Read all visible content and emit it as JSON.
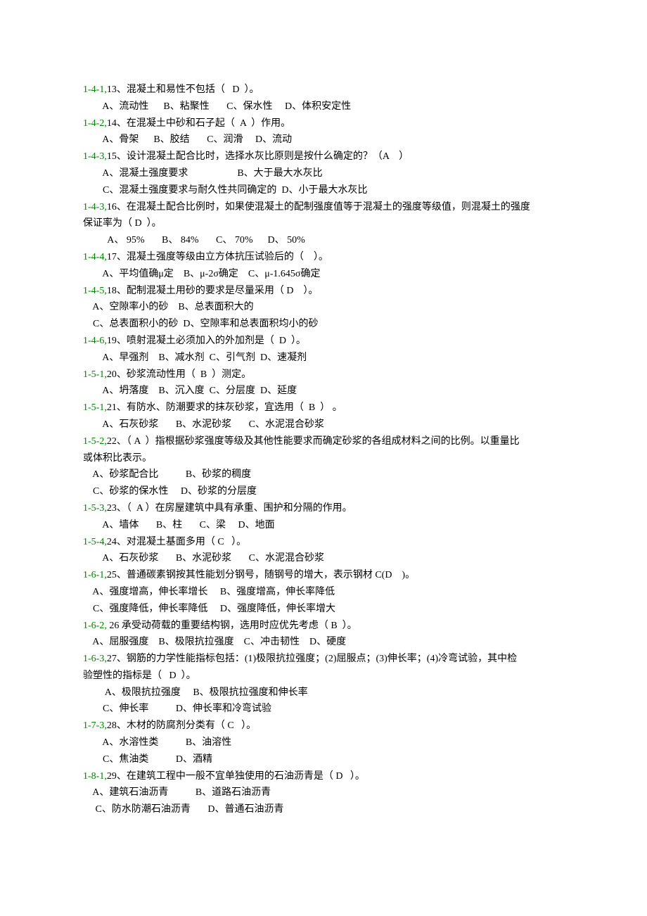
{
  "lines": [
    {
      "qnum": "1-4-1,",
      "rest": "13、混凝土和易性不包括（   D  ）。"
    },
    {
      "qnum": "",
      "rest": "        A、流动性      B、粘聚性       C、保水性     D、体积安定性"
    },
    {
      "qnum": "1-4-2,",
      "rest": "14、在混凝土中砂和石子起（  A  ）作用。"
    },
    {
      "qnum": "",
      "rest": "        A、骨架      B、胶结       C、润滑     D、流动"
    },
    {
      "qnum": "1-4-3,",
      "rest": "15、设计混凝土配合比时，选择水灰比原则是按什么确定的？（A    ）"
    },
    {
      "qnum": "",
      "rest": "        A、混凝土强度要求                    B、大于最大水灰比"
    },
    {
      "qnum": "",
      "rest": "        C、混凝土强度要求与耐久性共同确定的  D、小于最大水灰比"
    },
    {
      "qnum": "1-4-3,",
      "rest": "16、在混凝土配合比例时，如果使混凝土的配制强度值等于混凝土的强度等级值，则混凝土的强度"
    },
    {
      "qnum": "",
      "rest": "保证率为（ D  ）。"
    },
    {
      "qnum": "",
      "rest": "          A、 95%       B、 84%       C、 70%      D、 50%"
    },
    {
      "qnum": "1-4-4,",
      "rest": "17、混凝土强度等级由立方体抗压试验后的（    ）。"
    },
    {
      "qnum": "",
      "rest": "        A、平均值确μ定    B、μ-2σ确定    C、μ-1.645σ确定"
    },
    {
      "qnum": "1-4-5,",
      "rest": "18、配制混凝土用砂的要求是尽量采用（ D    ）。"
    },
    {
      "qnum": "",
      "rest": "    A、空隙率小的砂    B、总表面积大的"
    },
    {
      "qnum": "",
      "rest": "    C、总表面积小的砂  D、空隙率和总表面积均小的砂"
    },
    {
      "qnum": "1-4-6,",
      "rest": "19、喷射混凝土必须加入的外加剂是（  D  ）。"
    },
    {
      "qnum": "",
      "rest": "        A、早强剂    B、减水剂  C、引气剂  D、速凝剂"
    },
    {
      "qnum": "1-5-1,",
      "rest": "20、砂浆流动性用（  B  ）测定。"
    },
    {
      "qnum": "",
      "rest": "        A、坍落度    B、沉入度  C、分层度  D、延度"
    },
    {
      "qnum": "1-5-1,",
      "rest": "21、有防水、防潮要求的抹灰砂浆，宜选用（  B  ） 。"
    },
    {
      "qnum": "",
      "rest": "        A、石灰砂浆       B、水泥砂浆       C、水泥混合砂浆"
    },
    {
      "qnum": "1-5-2,",
      "rest": "22、（ A  ）指根据砂浆强度等级及其他性能要求而确定砂浆的各组成材料之间的比例。以重量比"
    },
    {
      "qnum": "",
      "rest": "或体积比表示。"
    },
    {
      "qnum": "",
      "rest": "    A、砂浆配合比           B、砂浆的稠度"
    },
    {
      "qnum": "",
      "rest": "    C、砂浆的保水性     D、砂浆的分层度"
    },
    {
      "qnum": "1-5-3,",
      "rest": "23、（  A ）在房屋建筑中具有承重、围护和分隔的作用。"
    },
    {
      "qnum": "",
      "rest": "        A、墙体       B、柱       C、梁     D、地面"
    },
    {
      "qnum": "1-5-4,",
      "rest": "24、对混凝土基面多用（ C   ）。"
    },
    {
      "qnum": "",
      "rest": "        A、石灰砂浆       B、水泥砂浆       C、水泥混合砂浆"
    },
    {
      "qnum": "1-6-1,",
      "rest": "25、普通碳素钢按其性能划分钢号，随钢号的增大，表示钢材 C(D    )。"
    },
    {
      "qnum": "",
      "rest": "    A、强度增高，伸长率增长     B、强度增高，伸长率降低"
    },
    {
      "qnum": "",
      "rest": "    C、强度降低，伸长率降低     D、强度降低，伸长率增大"
    },
    {
      "qnum": "1-6-2,",
      "rest": " 26 承受动荷载的重要结构钢，选用时应优先考虑（ B  ）。"
    },
    {
      "qnum": "",
      "rest": "    A、屈服强度    B、极限抗拉强度    C、冲击韧性    D、硬度"
    },
    {
      "qnum": "1-6-3,",
      "rest": "27、钢筋的力学性能指标包括：(1)极限抗拉强度；(2)屈服点；(3)伸长率；(4)冷弯试验，其中检"
    },
    {
      "qnum": "",
      "rest": "验塑性的指标是（   D  ）。"
    },
    {
      "qnum": "",
      "rest": "         A、极限抗拉强度     B、极限抗拉强度和伸长率"
    },
    {
      "qnum": "",
      "rest": "        C、伸长率           D、伸长率和冷弯试验"
    },
    {
      "qnum": "1-7-3,",
      "rest": "28、木材的防腐剂分类有（ C   ）。"
    },
    {
      "qnum": "",
      "rest": "        A、水溶性类           B、油溶性"
    },
    {
      "qnum": "",
      "rest": "        C、焦油类           D、酒精"
    },
    {
      "qnum": "1-8-1,",
      "rest": "29、在建筑工程中一般不宜单独使用的石油沥青是（ D   ）。"
    },
    {
      "qnum": "",
      "rest": "    A、建筑石油沥青           B、道路石油沥青"
    },
    {
      "qnum": "",
      "rest": "     C、防水防潮石油沥青       D、普通石油沥青"
    }
  ]
}
